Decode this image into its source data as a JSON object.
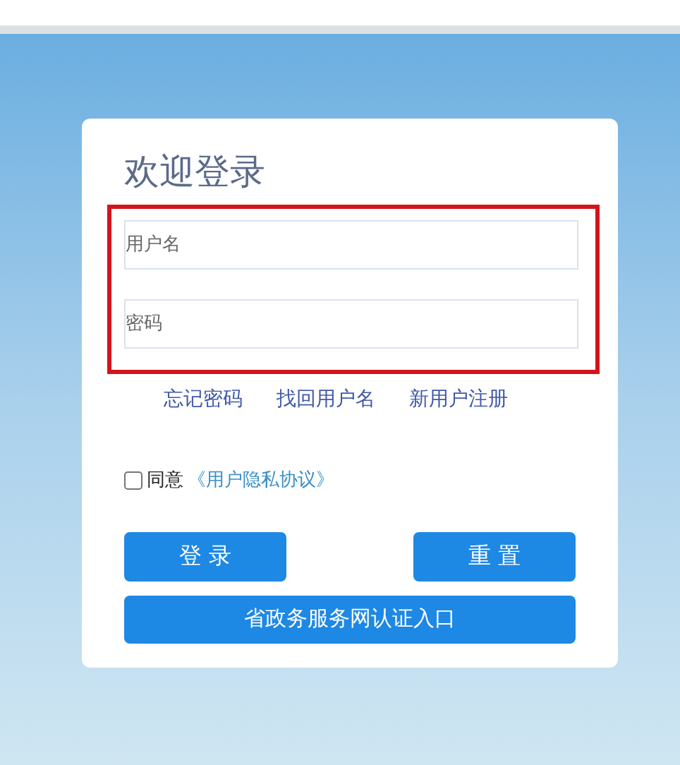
{
  "title": "欢迎登录",
  "fields": [
    {
      "placeholder": "用户名"
    },
    {
      "placeholder": "密码"
    }
  ],
  "links": [
    "忘记密码",
    "找回用户名",
    "新用户注册"
  ],
  "agreement": {
    "checked": false,
    "label": "同意",
    "link": "《用户隐私协议》"
  },
  "buttons": [
    "登 录",
    "重 置"
  ],
  "gov_button": "省政务服务网认证入口"
}
